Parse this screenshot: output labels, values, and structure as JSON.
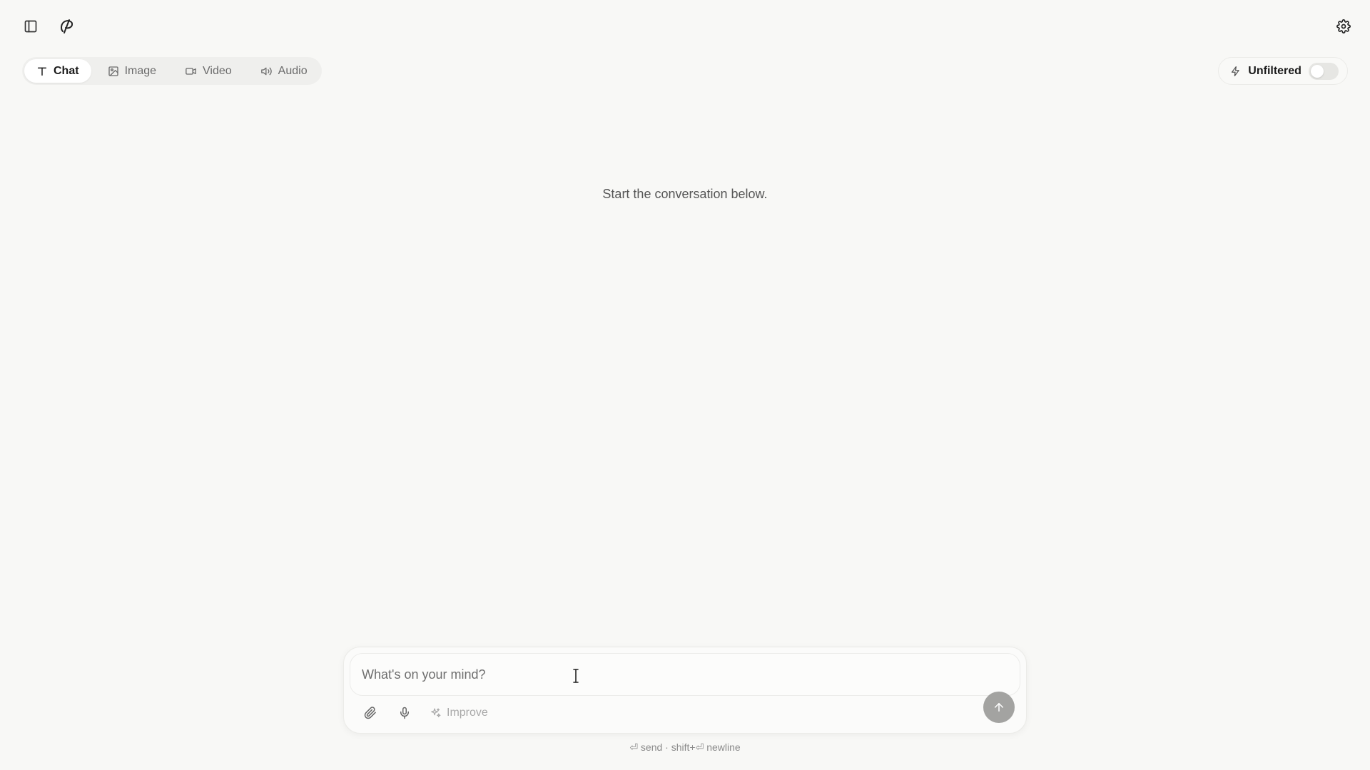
{
  "header": {
    "sidebar_toggle_icon": "sidebar-panel-icon",
    "logo_icon": "app-logo-icon",
    "settings_icon": "gear-icon"
  },
  "mode_tabs": [
    {
      "label": "Chat",
      "icon": "text-t-icon",
      "active": true
    },
    {
      "label": "Image",
      "icon": "image-icon",
      "active": false
    },
    {
      "label": "Video",
      "icon": "video-camera-icon",
      "active": false
    },
    {
      "label": "Audio",
      "icon": "speaker-icon",
      "active": false
    }
  ],
  "unfiltered": {
    "label": "Unfiltered",
    "icon": "lightning-icon",
    "enabled": false
  },
  "empty_state": {
    "message": "Start the conversation below."
  },
  "composer": {
    "placeholder": "What's on your mind?",
    "value": "",
    "attach_icon": "paperclip-icon",
    "mic_icon": "microphone-icon",
    "improve_label": "Improve",
    "improve_icon": "sparkles-icon",
    "send_icon": "arrow-up-icon"
  },
  "hint": {
    "text": "⏎ send · shift+⏎ newline"
  },
  "colors": {
    "background": "#f8f8f6",
    "send_button": "#a3a3a1",
    "toggle_off": "#e6e6e3"
  }
}
